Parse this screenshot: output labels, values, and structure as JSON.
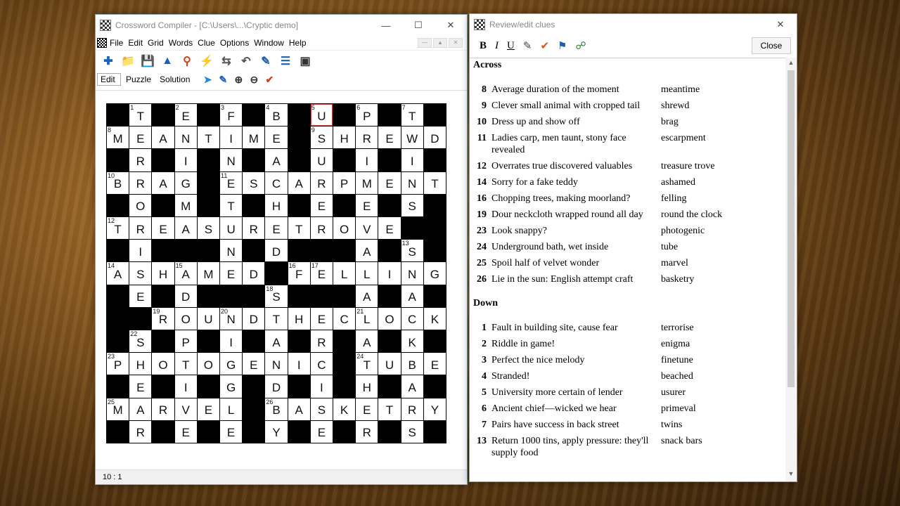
{
  "main_window": {
    "title": "Crossword Compiler - [C:\\Users\\...\\Cryptic demo]",
    "menu": [
      "File",
      "Edit",
      "Grid",
      "Words",
      "Clue",
      "Options",
      "Window",
      "Help"
    ],
    "tabs": [
      "Edit",
      "Puzzle",
      "Solution"
    ],
    "status": "10 : 1"
  },
  "grid": {
    "rows": [
      "#T#E#F#B#U#P#T#",
      "MEANTIME#SHREWD",
      "#R#I#N#A#U#I#I#",
      "BRAG#ESCARPMENT",
      "#O#M#T#H#E#E#S#",
      "TREASURETROVE##",
      "#I###N#D###A#S#",
      "ASHAMED#FELLING",
      "#E#D###S###A#A#",
      "##ROUNDTHECLOCK",
      "#S#P#I#A#R#A#K#",
      "PHOTOGENIC#TUBE",
      "#E#I#G#D#I#H#A#",
      "MARVEL#BASKETRY",
      "#R#E#E#Y#E#R#S#"
    ],
    "numbers": {
      "0,1": "1",
      "0,3": "2",
      "0,5": "3",
      "0,7": "4",
      "0,9": "5",
      "0,11": "6",
      "0,13": "7",
      "1,0": "8",
      "1,9": "9",
      "3,0": "10",
      "3,5": "11",
      "5,0": "12",
      "6,13": "13",
      "7,0": "14",
      "7,3": "15",
      "7,8": "16",
      "7,9": "17",
      "8,7": "18",
      "9,2": "19",
      "9,5": "20",
      "9,11": "21",
      "10,1": "22",
      "11,0": "23",
      "11,11": "24",
      "13,0": "25",
      "13,7": "26"
    }
  },
  "review": {
    "title": "Review/edit clues",
    "close_label": "Close",
    "toolbar": {
      "bold": "B",
      "italic": "I",
      "underline": "U"
    },
    "across_heading": "Across",
    "down_heading": "Down",
    "across": [
      {
        "n": "8",
        "clue": "Average duration of the moment",
        "answer": "meantime"
      },
      {
        "n": "9",
        "clue": "Clever small animal with cropped tail",
        "answer": "shrewd"
      },
      {
        "n": "10",
        "clue": "Dress up and show off",
        "answer": "brag"
      },
      {
        "n": "11",
        "clue": "Ladies carp, men taunt, stony face revealed",
        "answer": "escarpment"
      },
      {
        "n": "12",
        "clue": "Overrates true discovered valuables",
        "answer": "treasure trove"
      },
      {
        "n": "14",
        "clue": "Sorry for a fake teddy",
        "answer": "ashamed"
      },
      {
        "n": "16",
        "clue": "Chopping trees, making moorland?",
        "answer": "felling"
      },
      {
        "n": "19",
        "clue": "Dour neckcloth wrapped round all day",
        "answer": "round the clock"
      },
      {
        "n": "23",
        "clue": "Look snappy?",
        "answer": "photogenic"
      },
      {
        "n": "24",
        "clue": "Underground bath, wet inside",
        "answer": "tube"
      },
      {
        "n": "25",
        "clue": "Spoil half of velvet wonder",
        "answer": "marvel"
      },
      {
        "n": "26",
        "clue": "Lie in the sun: English attempt craft",
        "answer": "basketry"
      }
    ],
    "down": [
      {
        "n": "1",
        "clue": "Fault in building site, cause fear",
        "answer": "terrorise"
      },
      {
        "n": "2",
        "clue": "Riddle in game!",
        "answer": "enigma"
      },
      {
        "n": "3",
        "clue": "Perfect the nice melody",
        "answer": "finetune"
      },
      {
        "n": "4",
        "clue": "Stranded!",
        "answer": "beached"
      },
      {
        "n": "5",
        "clue": "University more certain of lender",
        "answer": "usurer"
      },
      {
        "n": "6",
        "clue": "Ancient chief—wicked we hear",
        "answer": "primeval"
      },
      {
        "n": "7",
        "clue": "Pairs have success in back street",
        "answer": "twins"
      },
      {
        "n": "13",
        "clue": "Return 1000 tins, apply pressure: they'll supply food",
        "answer": "snack bars"
      }
    ]
  }
}
